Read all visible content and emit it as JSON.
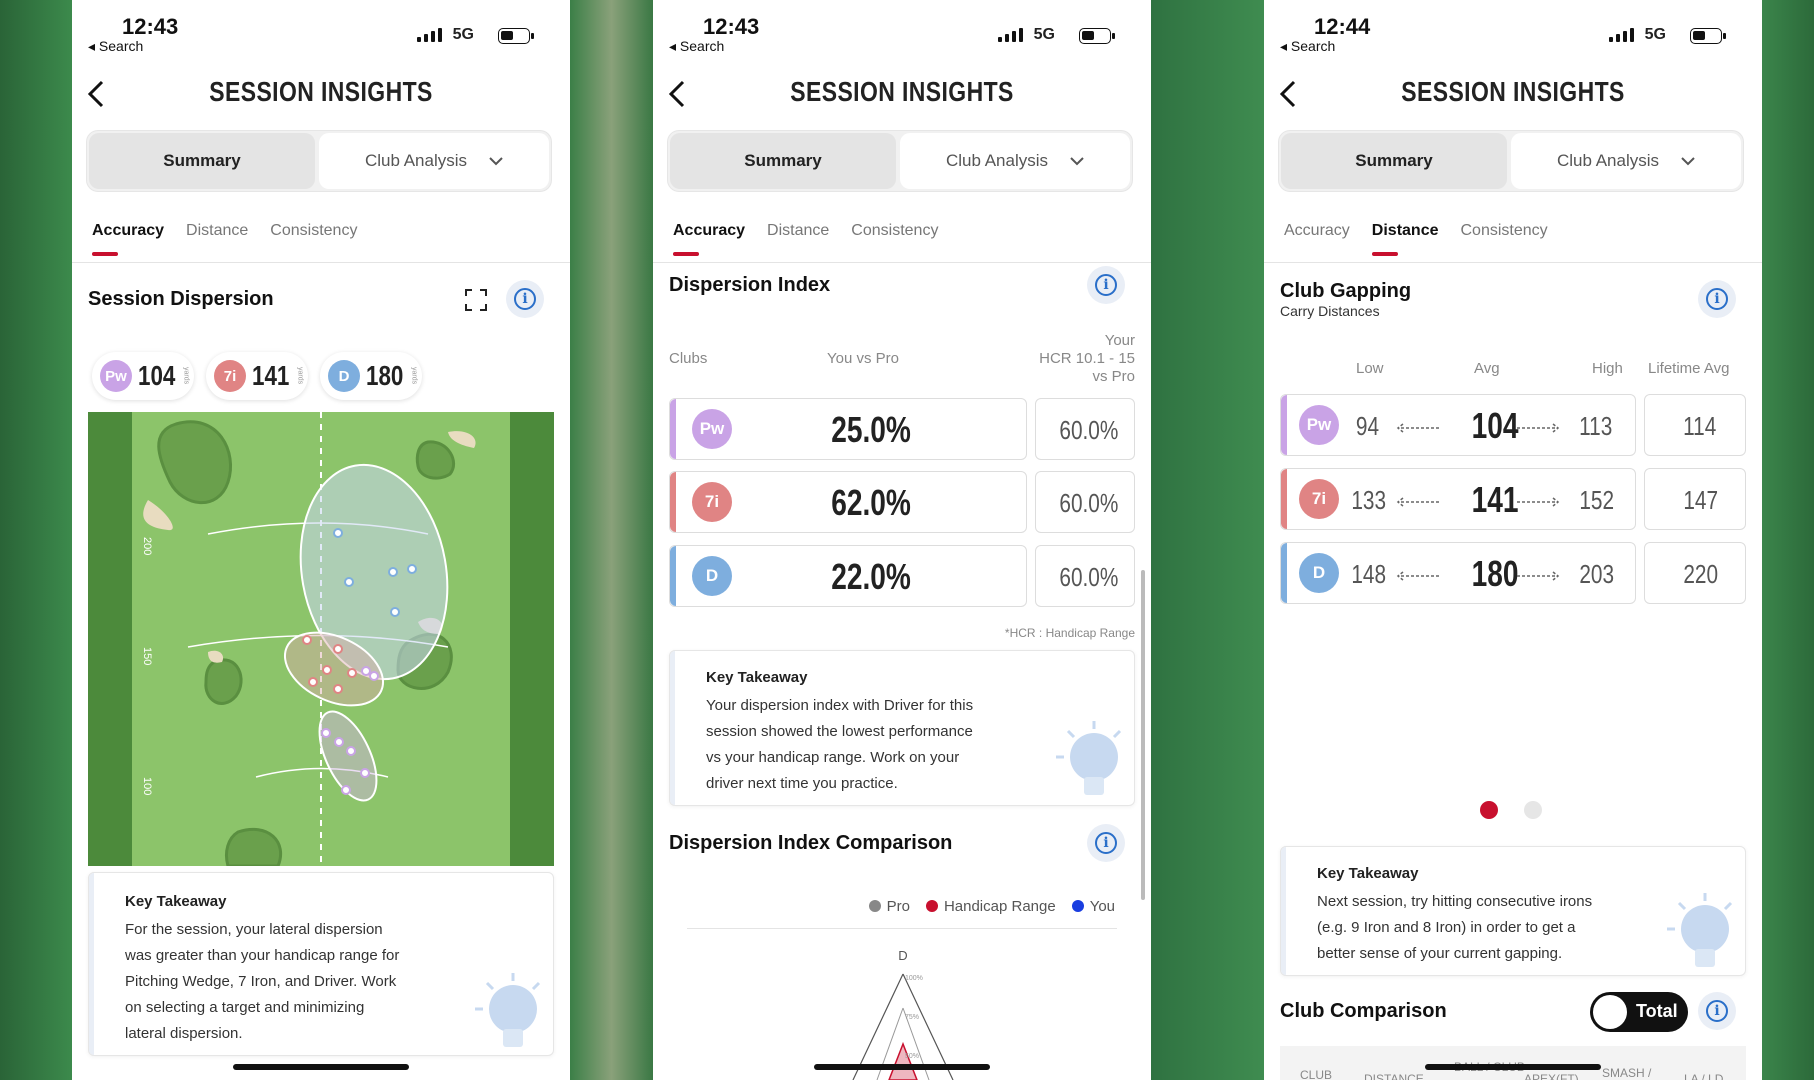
{
  "colors": {
    "accent": "#c8102e",
    "pw": "#c9a3e6",
    "i7": "#e08484",
    "driver": "#7eaede",
    "info": "#2a6fc9"
  },
  "screens": [
    {
      "status": {
        "time": "12:43",
        "back": "◂ Search",
        "network": "5G"
      },
      "title": "SESSION INSIGHTS",
      "segment": {
        "summary": "Summary",
        "club": "Club Analysis"
      },
      "tabs": [
        "Accuracy",
        "Distance",
        "Consistency"
      ],
      "section": "Session Dispersion",
      "chips": [
        {
          "club": "Pw",
          "value": "104"
        },
        {
          "club": "7i",
          "value": "141"
        },
        {
          "club": "D",
          "value": "180"
        }
      ],
      "chip_unit": "yards",
      "map_labels": [
        "200",
        "150",
        "100"
      ],
      "takeaway": {
        "heading": "Key Takeaway",
        "lines": [
          "For the session, your lateral dispersion",
          "was greater than your handicap range for",
          "Pitching Wedge, 7 Iron, and Driver. Work",
          "on selecting a target and minimizing",
          "lateral dispersion."
        ]
      }
    },
    {
      "status": {
        "time": "12:43",
        "back": "◂ Search",
        "network": "5G"
      },
      "title": "SESSION INSIGHTS",
      "segment": {
        "summary": "Summary",
        "club": "Club Analysis"
      },
      "tabs": [
        "Accuracy",
        "Distance",
        "Consistency"
      ],
      "section": "Dispersion Index",
      "headers": {
        "clubs": "Clubs",
        "you_vs_pro": "You vs Pro",
        "hcr_1": "Your",
        "hcr_2": "HCR 10.1 - 15",
        "hcr_3": "vs Pro"
      },
      "rows": [
        {
          "club": "Pw",
          "you": "25.0%",
          "hcr": "60.0%"
        },
        {
          "club": "7i",
          "you": "62.0%",
          "hcr": "60.0%"
        },
        {
          "club": "D",
          "you": "22.0%",
          "hcr": "60.0%"
        }
      ],
      "footnote": "*HCR : Handicap Range",
      "takeaway": {
        "heading": "Key Takeaway",
        "lines": [
          "Your dispersion index with Driver for this",
          "session showed the lowest performance",
          "vs your handicap range. Work on your",
          "driver next time you practice."
        ]
      },
      "comparison": {
        "title": "Dispersion Index Comparison",
        "legend": [
          "Pro",
          "Handicap Range",
          "You"
        ],
        "axis_label": "D",
        "ticks": [
          "100%",
          "75%",
          "50%"
        ]
      }
    },
    {
      "status": {
        "time": "12:44",
        "back": "◂ Search",
        "network": "5G"
      },
      "title": "SESSION INSIGHTS",
      "segment": {
        "summary": "Summary",
        "club": "Club Analysis"
      },
      "tabs": [
        "Accuracy",
        "Distance",
        "Consistency"
      ],
      "section": "Club Gapping",
      "subtitle": "Carry Distances",
      "headers": {
        "low": "Low",
        "avg": "Avg",
        "high": "High",
        "lifetime": "Lifetime Avg"
      },
      "rows": [
        {
          "club": "Pw",
          "low": "94",
          "avg": "104",
          "high": "113",
          "lifetime": "114"
        },
        {
          "club": "7i",
          "low": "133",
          "avg": "141",
          "high": "152",
          "lifetime": "147"
        },
        {
          "club": "D",
          "low": "148",
          "avg": "180",
          "high": "203",
          "lifetime": "220"
        }
      ],
      "takeaway": {
        "heading": "Key Takeaway",
        "lines": [
          "Next session, try hitting consecutive irons",
          "(e.g. 9 Iron and 8 Iron) in order to get a",
          "better sense of your current gapping."
        ]
      },
      "comparison": {
        "title": "Club Comparison",
        "toggle": "Total"
      },
      "table_headers": [
        "CLUB",
        "DISTANCE",
        "BALL / CLUB",
        "APEX(FT)",
        "SMASH / ",
        "LA / LD"
      ]
    }
  ]
}
